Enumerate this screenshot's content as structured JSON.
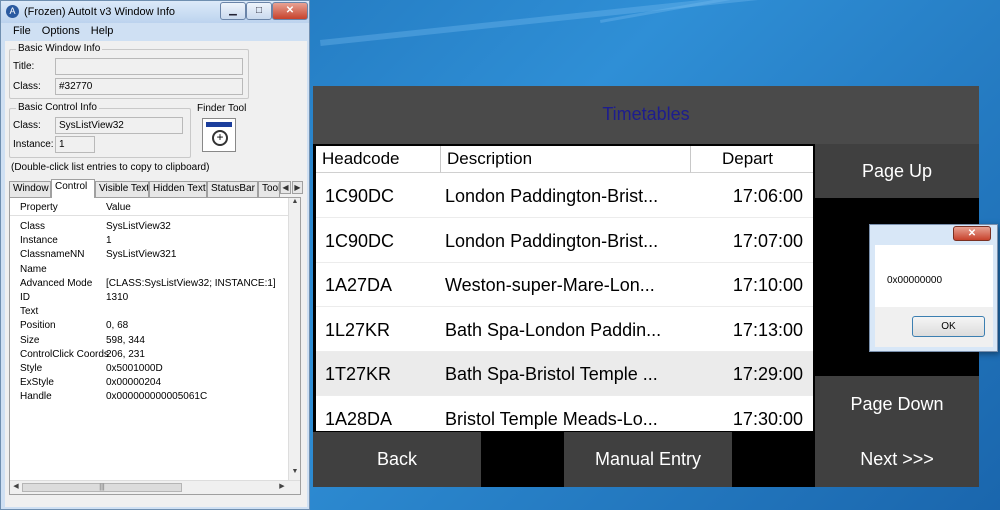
{
  "autoit": {
    "title": "(Frozen) AutoIt v3 Window Info",
    "menu": [
      "File",
      "Options",
      "Help"
    ],
    "basic_window": {
      "group_label": "Basic Window Info",
      "title_label": "Title:",
      "title_value": "",
      "class_label": "Class:",
      "class_value": "#32770"
    },
    "basic_control": {
      "group_label": "Basic Control Info",
      "class_label": "Class:",
      "class_value": "SysListView32",
      "instance_label": "Instance:",
      "instance_value": "1"
    },
    "finder_tool_label": "Finder Tool",
    "hint": "(Double-click list entries to copy to clipboard)",
    "tabs": [
      "Window",
      "Control",
      "Visible Text",
      "Hidden Text",
      "StatusBar",
      "Tool"
    ],
    "active_tab": "Control",
    "list_headers": [
      "Property",
      "Value"
    ],
    "properties": [
      {
        "property": "Class",
        "value": "SysListView32"
      },
      {
        "property": "Instance",
        "value": "1"
      },
      {
        "property": "ClassnameNN",
        "value": "SysListView321"
      },
      {
        "property": "Name",
        "value": ""
      },
      {
        "property": "Advanced Mode",
        "value": "[CLASS:SysListView32; INSTANCE:1]"
      },
      {
        "property": "ID",
        "value": "1310"
      },
      {
        "property": "Text",
        "value": ""
      },
      {
        "property": "Position",
        "value": "0, 68"
      },
      {
        "property": "Size",
        "value": "598, 344"
      },
      {
        "property": "ControlClick Coords",
        "value": "206, 231"
      },
      {
        "property": "Style",
        "value": "0x5001000D"
      },
      {
        "property": "ExStyle",
        "value": "0x00000204"
      },
      {
        "property": "Handle",
        "value": "0x000000000005061C"
      }
    ]
  },
  "timetables": {
    "title": "Timetables",
    "columns": [
      "Headcode",
      "Description",
      "Depart"
    ],
    "rows": [
      {
        "headcode": "1C90DC",
        "description": "London Paddington-Brist...",
        "depart": "17:06:00"
      },
      {
        "headcode": "1C90DC",
        "description": "London Paddington-Brist...",
        "depart": "17:07:00"
      },
      {
        "headcode": "1A27DA",
        "description": "Weston-super-Mare-Lon...",
        "depart": "17:10:00"
      },
      {
        "headcode": "1L27KR",
        "description": "Bath Spa-London Paddin...",
        "depart": "17:13:00"
      },
      {
        "headcode": "1T27KR",
        "description": "Bath Spa-Bristol Temple ...",
        "depart": "17:29:00"
      },
      {
        "headcode": "1A28DA",
        "description": "Bristol Temple Meads-Lo...",
        "depart": "17:30:00"
      }
    ],
    "page_up": "Page Up",
    "page_down": "Page Down",
    "back": "Back",
    "manual_entry": "Manual Entry",
    "next": "Next >>>"
  },
  "message_box": {
    "close_label": "✕",
    "text": "0x00000000",
    "ok_label": "OK"
  }
}
